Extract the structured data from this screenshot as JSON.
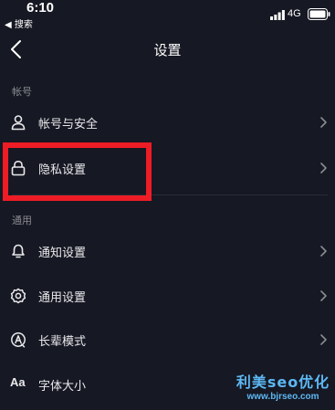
{
  "status_bar": {
    "time": "6:10",
    "back_app": "◀ 搜索",
    "network": "4G"
  },
  "nav": {
    "title": "设置"
  },
  "sections": {
    "account": {
      "header": "帐号",
      "items": [
        {
          "label": "帐号与安全",
          "icon": "user-icon"
        },
        {
          "label": "隐私设置",
          "icon": "lock-icon"
        }
      ]
    },
    "general": {
      "header": "通用",
      "items": [
        {
          "label": "通知设置",
          "icon": "bell-icon"
        },
        {
          "label": "通用设置",
          "icon": "gear-icon"
        },
        {
          "label": "长辈模式",
          "icon": "elder-mode-icon"
        },
        {
          "label": "字体大小",
          "icon": "font-size-icon",
          "glyph": "Aa"
        }
      ]
    }
  },
  "watermark": {
    "title": "利美seo优化",
    "url": "www.bjrseo.com"
  },
  "colors": {
    "background": "#161823",
    "highlight": "#ee1c25",
    "watermark": "#5db8f3"
  }
}
